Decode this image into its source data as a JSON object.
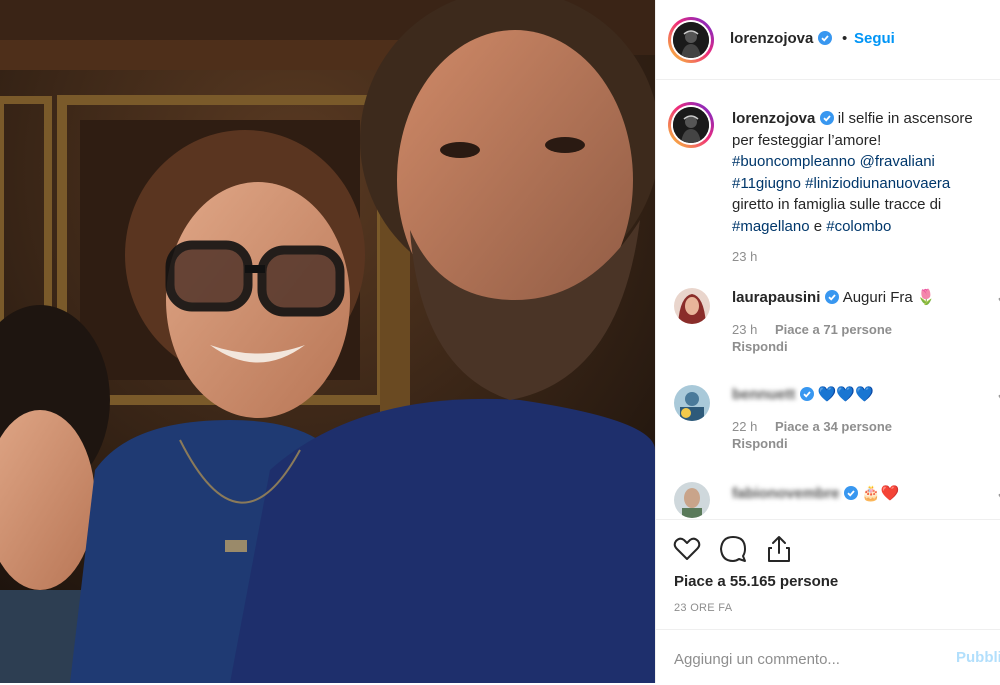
{
  "post": {
    "username": "lorenzojova",
    "separator": "•",
    "follow_label": "Segui"
  },
  "caption": {
    "username": "lorenzojova",
    "text_1": " il selfie in ascensore per festeggiar l’amore!",
    "tag_1": "#buoncompleanno",
    "tag_2": "@fravaliani",
    "tag_3": "#11giugno",
    "tag_4": "#liniziodiunanuovaera",
    "text_2": "giretto in famiglia sulle tracce di",
    "tag_5": "#magellano",
    "text_3": " e ",
    "tag_6": "#colombo",
    "time": "23 h"
  },
  "comments": [
    {
      "username": "laurapausini",
      "text": "Auguri Fra 🌷",
      "time": "23 h",
      "likes": "Piace a 71 persone",
      "reply": "Rispondi"
    },
    {
      "username": "bennuett",
      "text": "💙💙💙",
      "time": "22 h",
      "likes": "Piace a 34 persone",
      "reply": "Rispondi"
    },
    {
      "username": "fabionovembre",
      "text": "🎂❤️"
    }
  ],
  "actions": {
    "likes_label": "Piace a 55.165 persone",
    "date_label": "23 ORE FA"
  },
  "add_comment": {
    "placeholder": "Aggiungi un commento...",
    "publish_label": "Pubblica"
  },
  "icons": [
    "heart-icon",
    "comment-icon",
    "share-icon",
    "verified-badge-icon"
  ],
  "colors": {
    "link": "#0095f6",
    "hashtag": "#00376b",
    "muted": "#8e8e8e"
  }
}
